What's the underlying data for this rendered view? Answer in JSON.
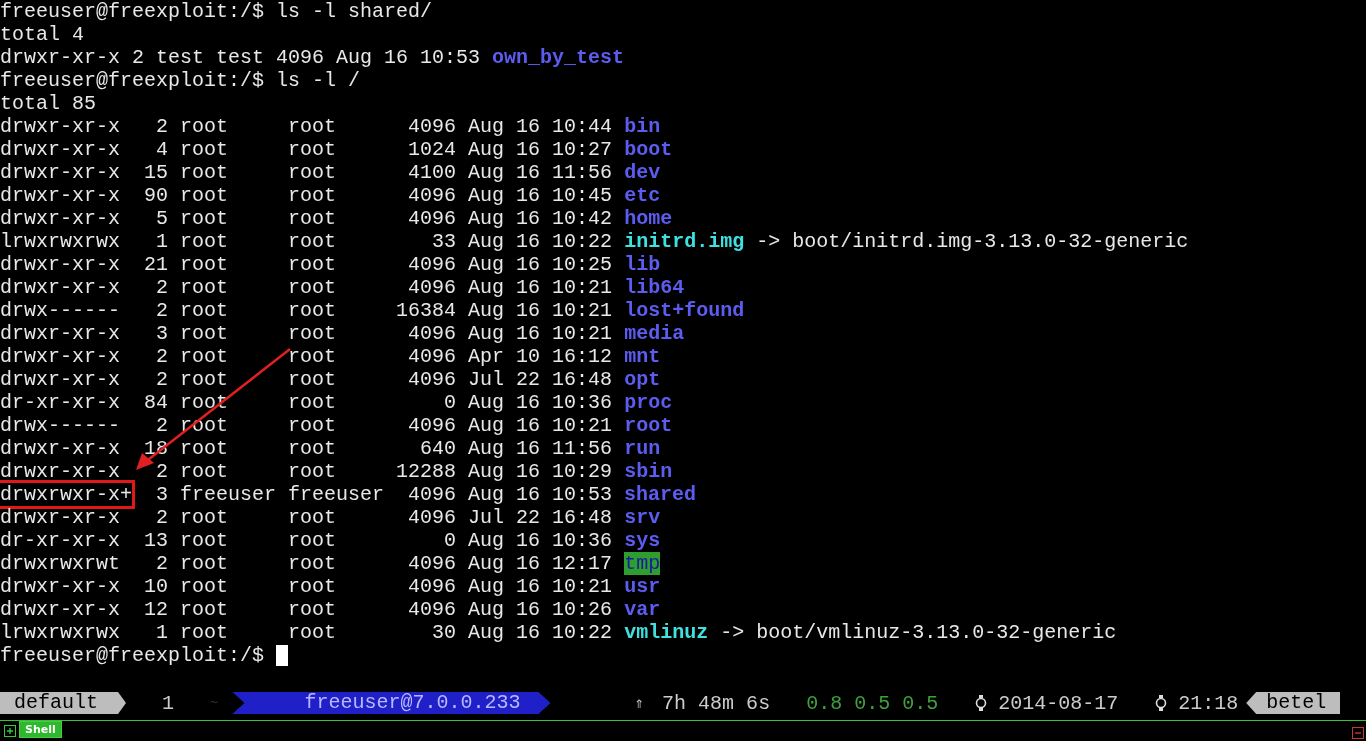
{
  "terminal": {
    "lines": [
      {
        "kind": "text",
        "text": "freeuser@freexploit:/$ ls -l shared/"
      },
      {
        "kind": "text",
        "text": "total 4"
      },
      {
        "kind": "entry",
        "perms": "drwxr-xr-x",
        "rest": " 2 test test 4096 Aug 16 10:53",
        "name": {
          "kind": "dir",
          "text": "own_by_test"
        },
        "boxed": false
      },
      {
        "kind": "text",
        "text": "freeuser@freexploit:/$ ls -l /"
      },
      {
        "kind": "text",
        "text": "total 85"
      },
      {
        "kind": "entry",
        "perms": "drwxr-xr-x",
        "rest": "   2 root     root      4096 Aug 16 10:44",
        "name": {
          "kind": "dir",
          "text": "bin"
        },
        "boxed": false
      },
      {
        "kind": "entry",
        "perms": "drwxr-xr-x",
        "rest": "   4 root     root      1024 Aug 16 10:27",
        "name": {
          "kind": "dir",
          "text": "boot"
        },
        "boxed": false
      },
      {
        "kind": "entry",
        "perms": "drwxr-xr-x",
        "rest": "  15 root     root      4100 Aug 16 11:56",
        "name": {
          "kind": "dir",
          "text": "dev"
        },
        "boxed": false
      },
      {
        "kind": "entry",
        "perms": "drwxr-xr-x",
        "rest": "  90 root     root      4096 Aug 16 10:45",
        "name": {
          "kind": "dir",
          "text": "etc"
        },
        "boxed": false
      },
      {
        "kind": "entry",
        "perms": "drwxr-xr-x",
        "rest": "   5 root     root      4096 Aug 16 10:42",
        "name": {
          "kind": "dir",
          "text": "home"
        },
        "boxed": false
      },
      {
        "kind": "entry",
        "perms": "lrwxrwxrwx",
        "rest": "   1 root     root        33 Aug 16 10:22",
        "name": {
          "kind": "link",
          "text": "initrd.img"
        },
        "target": "-> boot/initrd.img-3.13.0-32-generic",
        "boxed": false
      },
      {
        "kind": "entry",
        "perms": "drwxr-xr-x",
        "rest": "  21 root     root      4096 Aug 16 10:25",
        "name": {
          "kind": "dir",
          "text": "lib"
        },
        "boxed": false
      },
      {
        "kind": "entry",
        "perms": "drwxr-xr-x",
        "rest": "   2 root     root      4096 Aug 16 10:21",
        "name": {
          "kind": "dir",
          "text": "lib64"
        },
        "boxed": false
      },
      {
        "kind": "entry",
        "perms": "drwx------",
        "rest": "   2 root     root     16384 Aug 16 10:21",
        "name": {
          "kind": "dir",
          "text": "lost+found"
        },
        "boxed": false
      },
      {
        "kind": "entry",
        "perms": "drwxr-xr-x",
        "rest": "   3 root     root      4096 Aug 16 10:21",
        "name": {
          "kind": "dir",
          "text": "media"
        },
        "boxed": false
      },
      {
        "kind": "entry",
        "perms": "drwxr-xr-x",
        "rest": "   2 root     root      4096 Apr 10 16:12",
        "name": {
          "kind": "dir",
          "text": "mnt"
        },
        "boxed": false
      },
      {
        "kind": "entry",
        "perms": "drwxr-xr-x",
        "rest": "   2 root     root      4096 Jul 22 16:48",
        "name": {
          "kind": "dir",
          "text": "opt"
        },
        "boxed": false
      },
      {
        "kind": "entry",
        "perms": "dr-xr-xr-x",
        "rest": "  84 root     root         0 Aug 16 10:36",
        "name": {
          "kind": "dir",
          "text": "proc"
        },
        "boxed": false
      },
      {
        "kind": "entry",
        "perms": "drwx------",
        "rest": "   2 root     root      4096 Aug 16 10:21",
        "name": {
          "kind": "dir",
          "text": "root"
        },
        "boxed": false
      },
      {
        "kind": "entry",
        "perms": "drwxr-xr-x",
        "rest": "  18 root     root       640 Aug 16 11:56",
        "name": {
          "kind": "dir",
          "text": "run"
        },
        "boxed": false
      },
      {
        "kind": "entry",
        "perms": "drwxr-xr-x",
        "rest": "   2 root     root     12288 Aug 16 10:29",
        "name": {
          "kind": "dir",
          "text": "sbin"
        },
        "boxed": false
      },
      {
        "kind": "entry",
        "perms": "drwxrwxr-x+",
        "rest": "  3 freeuser freeuser  4096 Aug 16 10:53",
        "name": {
          "kind": "dir",
          "text": "shared"
        },
        "boxed": true
      },
      {
        "kind": "entry",
        "perms": "drwxr-xr-x",
        "rest": "   2 root     root      4096 Jul 22 16:48",
        "name": {
          "kind": "dir",
          "text": "srv"
        },
        "boxed": false
      },
      {
        "kind": "entry",
        "perms": "dr-xr-xr-x",
        "rest": "  13 root     root         0 Aug 16 10:36",
        "name": {
          "kind": "dir",
          "text": "sys"
        },
        "boxed": false
      },
      {
        "kind": "entry",
        "perms": "drwxrwxrwt",
        "rest": "   2 root     root      4096 Aug 16 12:17",
        "name": {
          "kind": "sticky",
          "text": "tmp"
        },
        "boxed": false
      },
      {
        "kind": "entry",
        "perms": "drwxr-xr-x",
        "rest": "  10 root     root      4096 Aug 16 10:21",
        "name": {
          "kind": "dir",
          "text": "usr"
        },
        "boxed": false
      },
      {
        "kind": "entry",
        "perms": "drwxr-xr-x",
        "rest": "  12 root     root      4096 Aug 16 10:26",
        "name": {
          "kind": "dir",
          "text": "var"
        },
        "boxed": false
      },
      {
        "kind": "entry",
        "perms": "lrwxrwxrwx",
        "rest": "   1 root     root        30 Aug 16 10:22",
        "name": {
          "kind": "link",
          "text": "vmlinuz"
        },
        "target": "-> boot/vmlinuz-3.13.0-32-generic",
        "boxed": false
      },
      {
        "kind": "prompt",
        "text": "freeuser@freexploit:/$",
        "cursor": true
      }
    ]
  },
  "status_bar": {
    "session": "default",
    "window_index": "1",
    "tilde": "~",
    "host": "freeuser@7.0.0.233",
    "uptime_icon": "⇑",
    "uptime": "7h 48m 6s",
    "load": "0.8 0.5 0.5",
    "date": "2014-08-17",
    "time": "21:18",
    "hostname": "betel"
  },
  "tab_bar": {
    "tabs": [
      {
        "label": "Shell",
        "selected": true
      }
    ]
  }
}
